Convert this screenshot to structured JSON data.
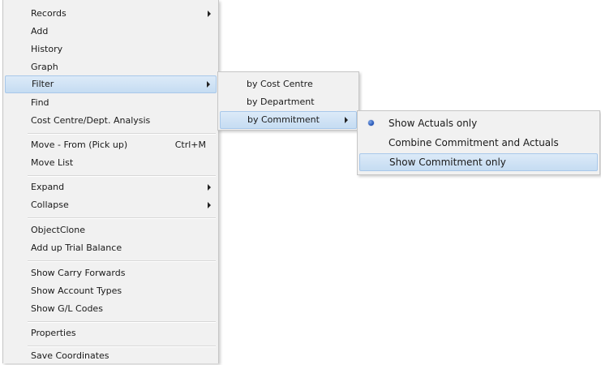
{
  "main_menu": {
    "items": [
      {
        "label": "Records",
        "submenu": true
      },
      {
        "label": "Add"
      },
      {
        "label": "History"
      },
      {
        "label": "Graph"
      },
      {
        "label": "Filter",
        "submenu": true,
        "highlighted": true
      },
      {
        "label": "Find"
      },
      {
        "label": "Cost Centre/Dept. Analysis"
      },
      {
        "label": "Move - From (Pick up)",
        "shortcut": "Ctrl+M"
      },
      {
        "label": "Move List"
      },
      {
        "label": "Expand",
        "submenu": true
      },
      {
        "label": "Collapse",
        "submenu": true
      },
      {
        "label": "ObjectClone"
      },
      {
        "label": "Add up Trial Balance"
      },
      {
        "label": "Show Carry Forwards"
      },
      {
        "label": "Show Account Types"
      },
      {
        "label": "Show G/L Codes"
      },
      {
        "label": "Properties"
      },
      {
        "label": "Save Coordinates"
      }
    ]
  },
  "filter_menu": {
    "items": [
      {
        "label": "by Cost Centre"
      },
      {
        "label": "by Department"
      },
      {
        "label": "by Commitment",
        "submenu": true,
        "highlighted": true
      }
    ]
  },
  "commitment_menu": {
    "items": [
      {
        "label": "Show Actuals only",
        "checked": true
      },
      {
        "label": "Combine Commitment and Actuals"
      },
      {
        "label": "Show Commitment only",
        "highlighted": true
      }
    ]
  },
  "colors": {
    "menu_background": "#f1f1f1",
    "highlight_background": "#c5dcf2",
    "highlight_border": "#a8c8ea",
    "radio_bullet": "#1f4fb3"
  }
}
